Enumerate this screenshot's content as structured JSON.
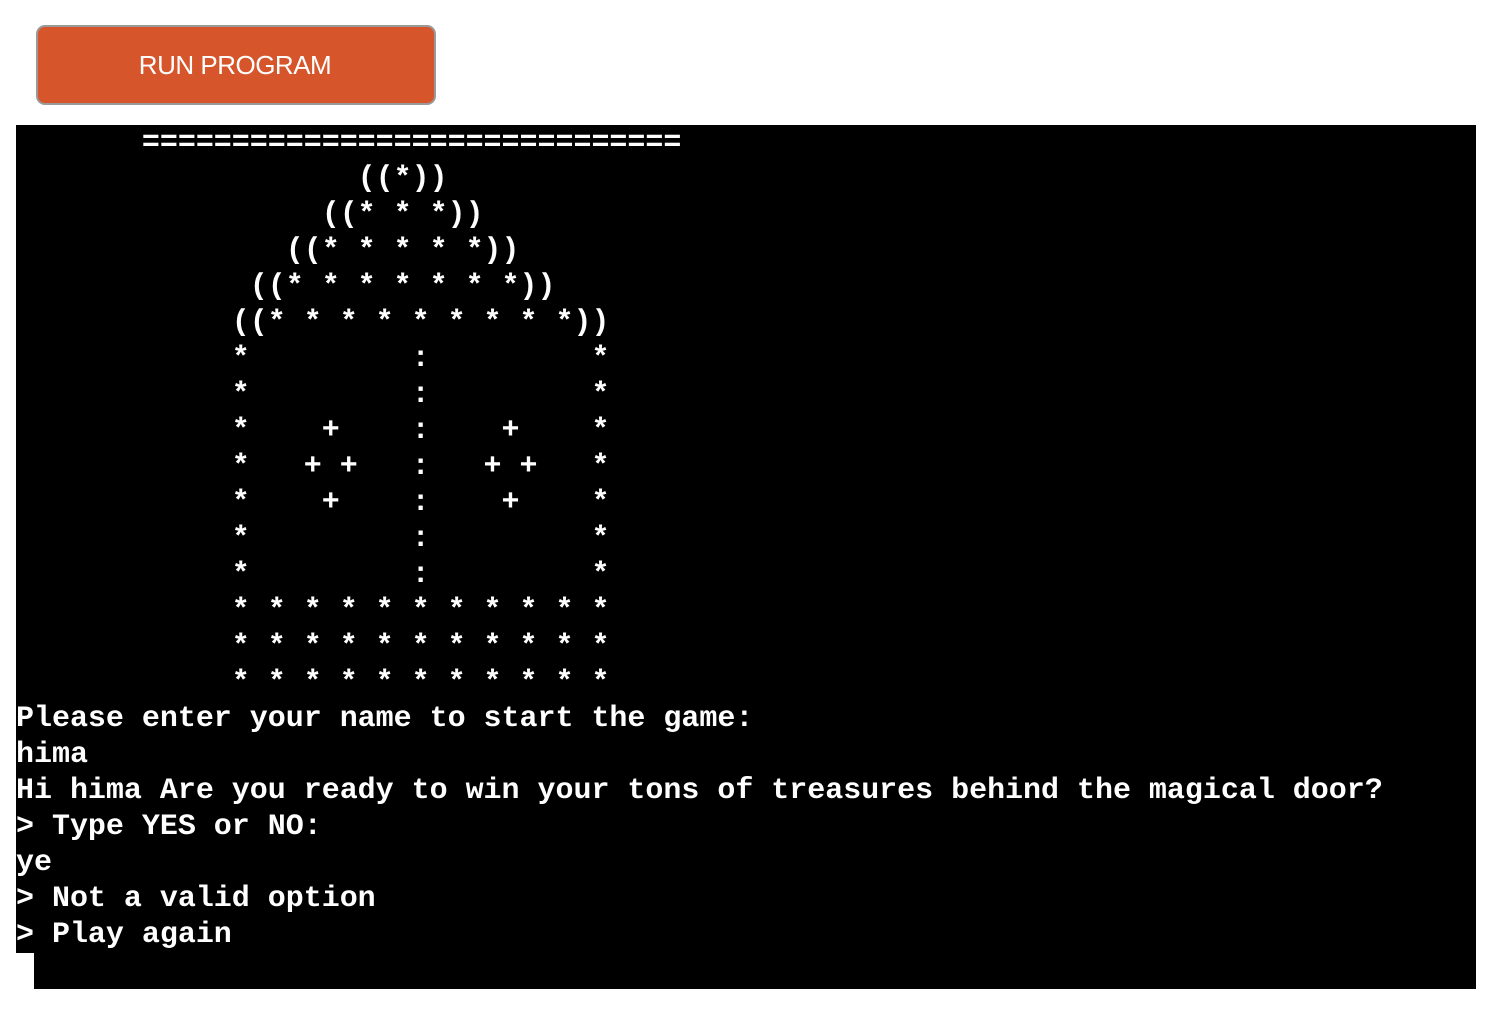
{
  "toolbar": {
    "run_label": "RUN PROGRAM",
    "run_color": "#d6552b"
  },
  "terminal": {
    "background": "#000000",
    "foreground": "#ffffff",
    "art": [
      "       ==============================",
      "                   ((*))",
      "                 ((* * *))",
      "               ((* * * * *))",
      "             ((* * * * * * *))",
      "            ((* * * * * * * * *))",
      "            *         :         *",
      "            *         :         *",
      "            *    +    :    +    *",
      "            *   + +   :   + +   *",
      "            *    +    :    +    *",
      "            *         :         *",
      "            *         :         *",
      "            * * * * * * * * * * *",
      "            * * * * * * * * * * *",
      "            * * * * * * * * * * *"
    ],
    "lines": [
      "Please enter your name to start the game:",
      "hima",
      "Hi hima Are you ready to win your tons of treasures behind the magical door?",
      "> Type YES or NO:",
      "ye",
      "> Not a valid option",
      "> Play again"
    ]
  }
}
